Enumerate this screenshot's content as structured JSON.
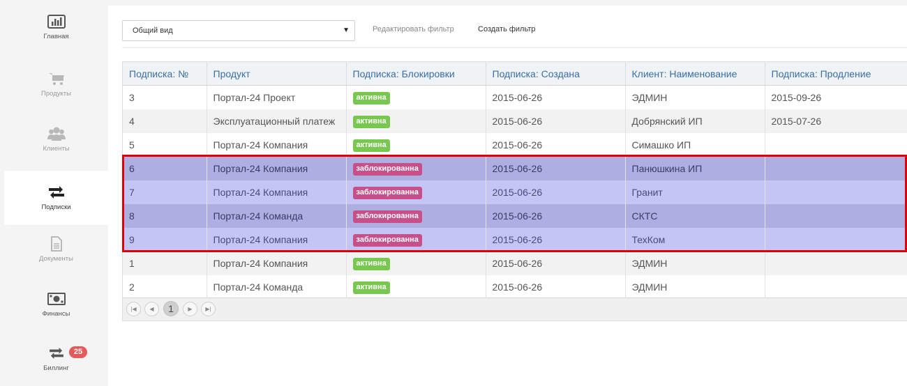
{
  "sidebar": {
    "items": [
      {
        "label": "Главная",
        "icon": "bar-chart-icon"
      },
      {
        "label": "Продукты",
        "icon": "cart-icon"
      },
      {
        "label": "Клиенты",
        "icon": "users-icon"
      },
      {
        "label": "Подписки",
        "icon": "retweet-icon"
      },
      {
        "label": "Документы",
        "icon": "document-icon"
      },
      {
        "label": "Финансы",
        "icon": "money-icon"
      },
      {
        "label": "Биллинг",
        "icon": "retweet-icon"
      }
    ],
    "billing_badge": "25"
  },
  "toolbar": {
    "view_select_value": "Общий вид",
    "edit_filter_label": "Редактировать фильтр",
    "create_filter_label": "Создать фильтр"
  },
  "table": {
    "columns": [
      "Подписка: №",
      "Продукт",
      "Подписка: Блокировки",
      "Подписка: Создана",
      "Клиент: Наименование",
      "Подписка: Продление"
    ],
    "rows": [
      {
        "num": "3",
        "product": "Портал-24 Проект",
        "status": "активна",
        "created": "2015-06-26",
        "client": "ЭДМИН",
        "renewal": "2015-09-26"
      },
      {
        "num": "4",
        "product": "Эксплуатационный платеж",
        "status": "активна",
        "created": "2015-06-26",
        "client": "Добрянский ИП",
        "renewal": "2015-07-26"
      },
      {
        "num": "5",
        "product": "Портал-24 Компания",
        "status": "активна",
        "created": "2015-06-26",
        "client": "Симашко ИП",
        "renewal": ""
      },
      {
        "num": "6",
        "product": "Портал-24 Компания",
        "status": "заблокированна",
        "created": "2015-06-26",
        "client": "Панюшкина ИП",
        "renewal": ""
      },
      {
        "num": "7",
        "product": "Портал-24 Компания",
        "status": "заблокированна",
        "created": "2015-06-26",
        "client": "Гранит",
        "renewal": ""
      },
      {
        "num": "8",
        "product": "Портал-24 Команда",
        "status": "заблокированна",
        "created": "2015-06-26",
        "client": "СКТС",
        "renewal": ""
      },
      {
        "num": "9",
        "product": "Портал-24 Компания",
        "status": "заблокированна",
        "created": "2015-06-26",
        "client": "ТехКом",
        "renewal": ""
      },
      {
        "num": "1",
        "product": "Портал-24 Компания",
        "status": "активна",
        "created": "2015-06-26",
        "client": "ЭДМИН",
        "renewal": ""
      },
      {
        "num": "2",
        "product": "Портал-24 Команда",
        "status": "активна",
        "created": "2015-06-26",
        "client": "ЭДМИН",
        "renewal": ""
      }
    ]
  },
  "pager": {
    "current_page": "1"
  },
  "colors": {
    "active_tag": "#78c850",
    "blocked_tag": "#c8508a",
    "selected_row": "#c5c5f5",
    "highlight_border": "#e00000",
    "header_text": "#3a6ea5"
  }
}
